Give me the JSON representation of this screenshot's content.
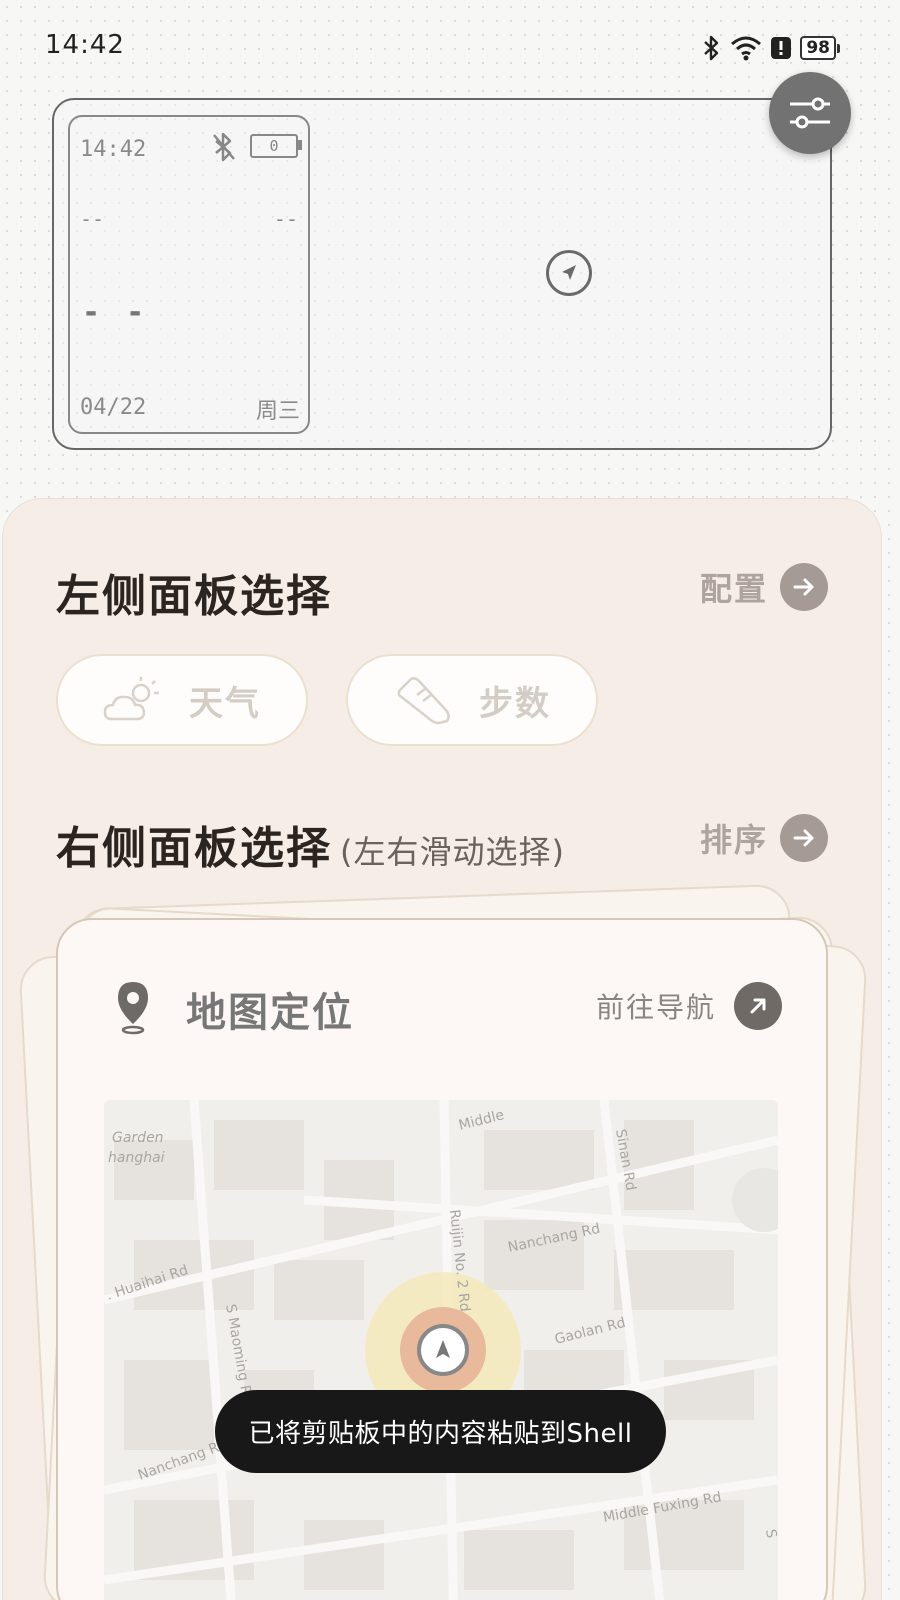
{
  "status_bar": {
    "time": "14:42",
    "battery": "98",
    "icons": [
      "bluetooth-icon",
      "wifi-icon",
      "alert-icon",
      "battery-icon"
    ]
  },
  "preview": {
    "time": "14:42",
    "battery": "0",
    "left_value": "--",
    "right_value": "--",
    "main_value": "- -",
    "date": "04/22",
    "weekday": "周三"
  },
  "left_panel": {
    "title": "左侧面板选择",
    "action_label": "配置",
    "chips": [
      {
        "label": "天气",
        "icon": "weather-cloud-sun-icon"
      },
      {
        "label": "步数",
        "icon": "sneaker-icon"
      }
    ]
  },
  "right_panel": {
    "title": "右侧面板选择",
    "subtitle": "(左右滑动选择)",
    "action_label": "排序"
  },
  "map_card": {
    "title": "地图定位",
    "action_label": "前往导航",
    "map_labels": {
      "garden": "Garden",
      "shanghai": "hanghai",
      "middle_top": "Middle",
      "sinan": "Sinan Rd",
      "ruijin": "Ruijin No. 2 Rd",
      "nanchang_top": "Nanchang Rd",
      "huaihai": ". Huaihai Rd",
      "maoming": "S Maoming R",
      "gaolan": "Gaolan Rd",
      "nanchang_bottom": "Nanchang R",
      "fuxing": "Middle Fuxing Rd",
      "s_edge": "S"
    }
  },
  "toast": {
    "message": "已将剪贴板中的内容粘贴到Shell"
  },
  "colors": {
    "panel_bg": "#f6ede6",
    "toast_bg": "#181818",
    "accent_gray": "#a59a94"
  }
}
